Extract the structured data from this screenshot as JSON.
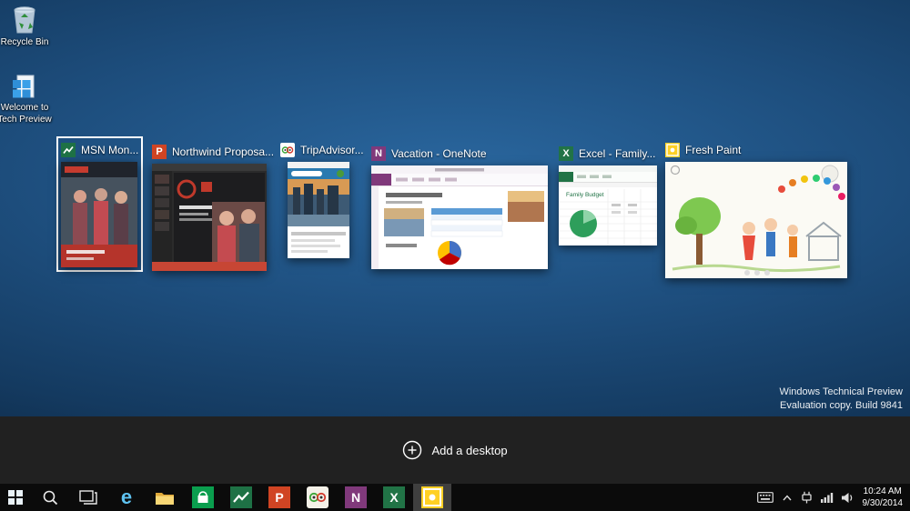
{
  "desktop": {
    "icons": [
      {
        "id": "recycle-bin",
        "label": "Recycle Bin"
      },
      {
        "id": "welcome-tech-preview",
        "label": "Welcome to Tech Preview"
      }
    ],
    "watermark": {
      "line1": "Windows Technical Preview",
      "line2": "Evaluation copy. Build 9841"
    }
  },
  "task_view": {
    "add_desktop_label": "Add a desktop",
    "windows": [
      {
        "title": "MSN Mon...",
        "app": "MSN Money",
        "selected": true
      },
      {
        "title": "Northwind Proposa...",
        "app": "PowerPoint",
        "selected": false
      },
      {
        "title": "TripAdvisor...",
        "app": "TripAdvisor",
        "selected": false
      },
      {
        "title": "Vacation - OneNote",
        "app": "OneNote",
        "selected": false
      },
      {
        "title": "Excel - Family...",
        "app": "Excel",
        "selected": false
      },
      {
        "title": "Fresh Paint",
        "app": "Fresh Paint",
        "selected": false
      }
    ],
    "thumbnail_texts": {
      "excel_heading": "Family Budget"
    }
  },
  "app_glyphs": {
    "powerpoint": "P",
    "onenote": "N",
    "excel": "X",
    "ie": "e"
  },
  "taskbar": {
    "buttons": [
      {
        "name": "start"
      },
      {
        "name": "search"
      },
      {
        "name": "task-view"
      },
      {
        "name": "internet-explorer"
      },
      {
        "name": "file-explorer"
      },
      {
        "name": "store"
      },
      {
        "name": "msn-money"
      },
      {
        "name": "powerpoint"
      },
      {
        "name": "tripadvisor"
      },
      {
        "name": "onenote"
      },
      {
        "name": "excel"
      },
      {
        "name": "fresh-paint",
        "active": true
      }
    ],
    "tray": {
      "icons": [
        "touch-keyboard",
        "show-hidden-icons",
        "power",
        "network",
        "volume"
      ],
      "time": "10:24 AM",
      "date": "9/30/2014"
    }
  },
  "colors": {
    "selection_border": "#ffffff",
    "excel_green": "#217346",
    "powerpoint_orange": "#d04423",
    "onenote_purple": "#80397b",
    "msn_green": "#1e7145",
    "store_green": "#0a9e4e",
    "fresh_paint_yellow": "#ffd024",
    "taskbar_black": "#0b0b0b"
  }
}
